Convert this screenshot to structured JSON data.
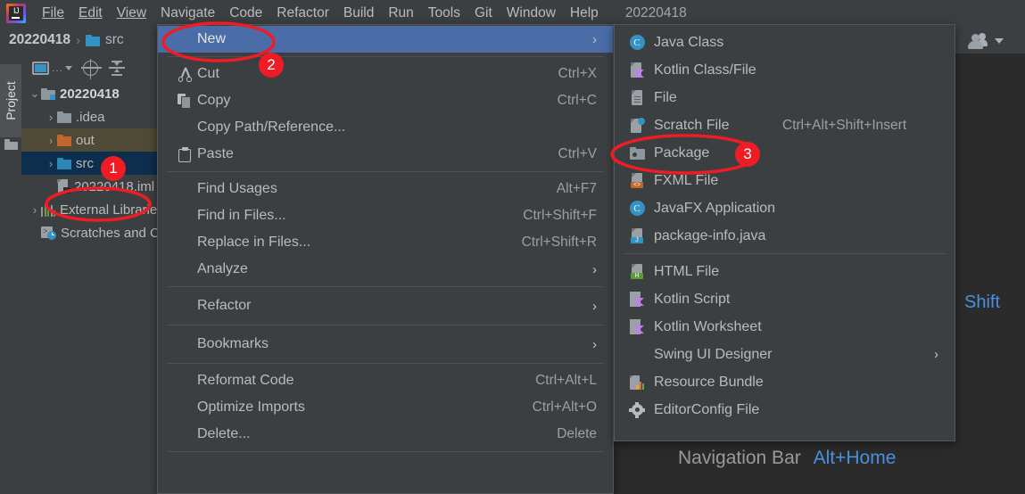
{
  "app": {
    "logo_label": "IJ",
    "project_title": "20220418"
  },
  "menubar": {
    "items": [
      {
        "label": "File"
      },
      {
        "label": "Edit"
      },
      {
        "label": "View"
      },
      {
        "label": "Navigate"
      },
      {
        "label": "Code"
      },
      {
        "label": "Refactor"
      },
      {
        "label": "Build"
      },
      {
        "label": "Run"
      },
      {
        "label": "Tools"
      },
      {
        "label": "Git"
      },
      {
        "label": "Window"
      },
      {
        "label": "Help"
      }
    ]
  },
  "navbar": {
    "crumb_project": "20220418",
    "crumb_sep": "›",
    "crumb_folder": "src",
    "users_icon": "users-icon",
    "chevron_icon": "chevron-down-icon"
  },
  "toolwindow_stripe": {
    "project_tab": "Project",
    "folder_icon": "folder-icon"
  },
  "project_panel": {
    "toolbar": {
      "project_view_label": "...",
      "project_view_icon": "project-view-icon",
      "locate_icon": "locate-target-icon",
      "collapse_icon": "collapse-all-icon"
    },
    "tree": [
      {
        "label": "20220418",
        "arrow": "⌄",
        "icon": "module-folder-icon",
        "state": "expanded-root"
      },
      {
        "label": ".idea",
        "arrow": "›",
        "icon": "folder-gray-icon",
        "state": "collapsed"
      },
      {
        "label": "out",
        "arrow": "›",
        "icon": "folder-orange-icon",
        "state": "hovered"
      },
      {
        "label": "src",
        "arrow": "›",
        "icon": "folder-blue-icon",
        "state": "selected"
      },
      {
        "label": "20220418.iml",
        "arrow": "",
        "icon": "iml-file-icon",
        "state": "leaf"
      },
      {
        "label": "External Libraries",
        "arrow": "›",
        "icon": "libraries-icon",
        "state": "collapsed"
      },
      {
        "label": "Scratches and Consoles",
        "arrow": "",
        "icon": "scratches-icon",
        "state": "leaf"
      }
    ]
  },
  "context_menu": {
    "items": [
      {
        "type": "item",
        "label": "New",
        "mnemonic": "",
        "shortcut": "",
        "arrow": "›",
        "icon": "",
        "highlighted": true
      },
      {
        "type": "separator"
      },
      {
        "type": "item",
        "label": "Cut",
        "shortcut": "Ctrl+X",
        "icon": "scissors-icon"
      },
      {
        "type": "item",
        "label": "Copy",
        "shortcut": "Ctrl+C",
        "icon": "copy-icon"
      },
      {
        "type": "item",
        "label": "Copy Path/Reference...",
        "shortcut": "",
        "icon": ""
      },
      {
        "type": "item",
        "label": "Paste",
        "shortcut": "Ctrl+V",
        "icon": "clipboard-icon"
      },
      {
        "type": "separator"
      },
      {
        "type": "item",
        "label": "Find Usages",
        "shortcut": "Alt+F7",
        "icon": ""
      },
      {
        "type": "item",
        "label": "Find in Files...",
        "shortcut": "Ctrl+Shift+F",
        "icon": ""
      },
      {
        "type": "item",
        "label": "Replace in Files...",
        "shortcut": "Ctrl+Shift+R",
        "icon": ""
      },
      {
        "type": "item",
        "label": "Analyze",
        "shortcut": "",
        "arrow": "›",
        "icon": ""
      },
      {
        "type": "separator"
      },
      {
        "type": "item",
        "label": "Refactor",
        "shortcut": "",
        "arrow": "›",
        "icon": ""
      },
      {
        "type": "separator"
      },
      {
        "type": "item",
        "label": "Bookmarks",
        "shortcut": "",
        "arrow": "›",
        "icon": ""
      },
      {
        "type": "separator"
      },
      {
        "type": "item",
        "label": "Reformat Code",
        "shortcut": "Ctrl+Alt+L",
        "icon": ""
      },
      {
        "type": "item",
        "label": "Optimize Imports",
        "shortcut": "Ctrl+Alt+O",
        "icon": ""
      },
      {
        "type": "item",
        "label": "Delete...",
        "shortcut": "Delete",
        "icon": ""
      },
      {
        "type": "separator"
      }
    ]
  },
  "new_submenu": {
    "items": [
      {
        "label": "Java Class",
        "shortcut": "",
        "icon": "java-class-icon"
      },
      {
        "label": "Kotlin Class/File",
        "shortcut": "",
        "icon": "kotlin-class-icon"
      },
      {
        "label": "File",
        "shortcut": "",
        "icon": "file-icon"
      },
      {
        "label": "Scratch File",
        "shortcut": "Ctrl+Alt+Shift+Insert",
        "icon": "scratch-file-icon"
      },
      {
        "label": "Package",
        "shortcut": "",
        "icon": "package-icon"
      },
      {
        "label": "FXML File",
        "shortcut": "",
        "icon": "fxml-file-icon"
      },
      {
        "label": "JavaFX Application",
        "shortcut": "",
        "icon": "javafx-application-icon"
      },
      {
        "label": "package-info.java",
        "shortcut": "",
        "icon": "java-file-icon"
      },
      {
        "type": "separator"
      },
      {
        "label": "HTML File",
        "shortcut": "",
        "icon": "html-file-icon"
      },
      {
        "label": "Kotlin Script",
        "shortcut": "",
        "icon": "kotlin-script-icon"
      },
      {
        "label": "Kotlin Worksheet",
        "shortcut": "",
        "icon": "kotlin-worksheet-icon"
      },
      {
        "label": "Swing UI Designer",
        "shortcut": "",
        "arrow": "›",
        "icon": ""
      },
      {
        "label": "Resource Bundle",
        "shortcut": "",
        "icon": "resource-bundle-icon"
      },
      {
        "label": "EditorConfig File",
        "shortcut": "",
        "icon": "gear-icon"
      }
    ]
  },
  "annotations": {
    "badges": [
      {
        "label": "1"
      },
      {
        "label": "2"
      },
      {
        "label": "3"
      }
    ],
    "ellipse_color": "#ee1c25",
    "badge_color": "#ee1c25"
  },
  "hints": {
    "shift_key": "Shift",
    "navigation_bar_label": "Navigation Bar",
    "navigation_bar_shortcut": "Alt+Home"
  },
  "colors": {
    "panel_bg": "#3c3f41",
    "editor_bg": "#2b2b2b",
    "menu_highlight": "#4a6da7",
    "tree_selected": "#0d2e4d",
    "tree_hovered": "#4f4a36",
    "accent_blue": "#4a90e2",
    "annotation_red": "#ee1c25"
  }
}
